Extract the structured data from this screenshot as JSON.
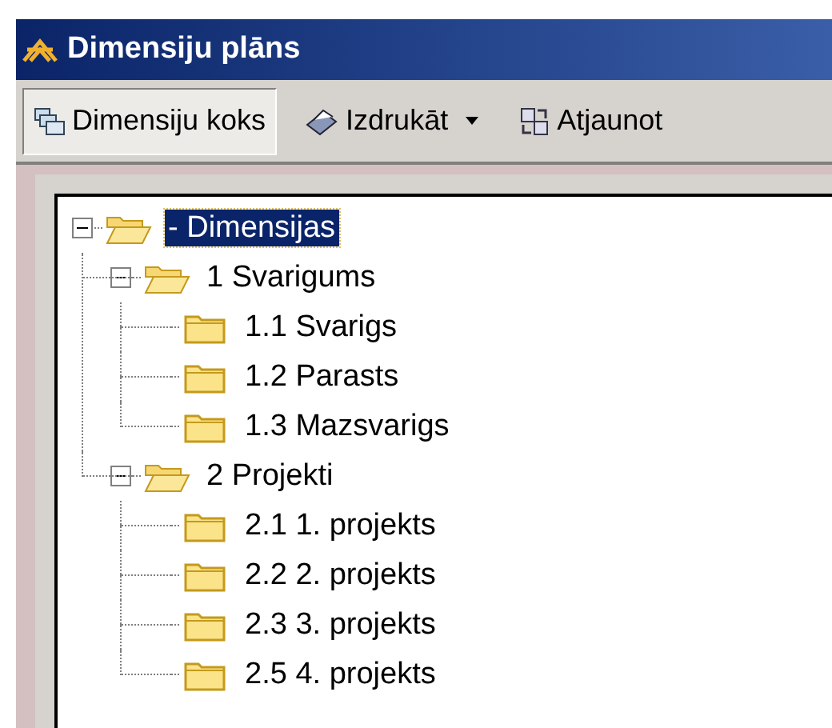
{
  "window": {
    "title": "Dimensiju plāns"
  },
  "toolbar": [
    {
      "label": "Dimensiju koks",
      "kind": "toggle",
      "selected": true
    },
    {
      "label": "Izdrukāt",
      "kind": "dropdown",
      "selected": false
    },
    {
      "label": "Atjaunot",
      "kind": "refresh",
      "selected": false
    }
  ],
  "tree": [
    {
      "label": "- Dimensijas",
      "expanded": true,
      "selected": true,
      "children": [
        {
          "label": "1 Svarigums",
          "expanded": true,
          "selected": false,
          "children": [
            {
              "label": "1.1 Svarigs",
              "selected": false
            },
            {
              "label": "1.2 Parasts",
              "selected": false
            },
            {
              "label": "1.3 Mazsvarigs",
              "selected": false
            }
          ]
        },
        {
          "label": "2 Projekti",
          "expanded": true,
          "selected": false,
          "children": [
            {
              "label": "2.1 1. projekts",
              "selected": false
            },
            {
              "label": "2.2 2. projekts",
              "selected": false
            },
            {
              "label": "2.3 3. projekts",
              "selected": false
            },
            {
              "label": "2.5 4. projekts",
              "selected": false
            }
          ]
        }
      ]
    }
  ]
}
